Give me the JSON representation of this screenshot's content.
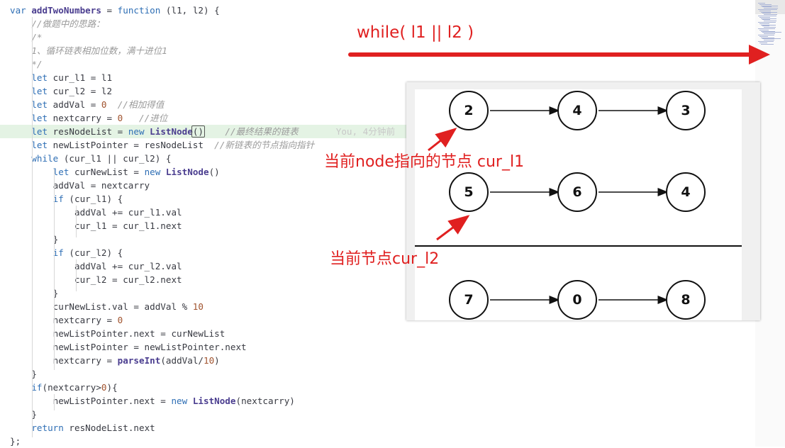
{
  "editor": {
    "lines": [
      {
        "segments": [
          {
            "t": "var ",
            "c": "kw"
          },
          {
            "t": "addTwoNumbers",
            "c": "fn"
          },
          {
            "t": " = "
          },
          {
            "t": "function",
            "c": "kw"
          },
          {
            "t": " (l1, l2) {"
          }
        ]
      },
      {
        "segments": [
          {
            "t": "    "
          },
          {
            "t": "//做题中的思路：",
            "c": "cm"
          }
        ]
      },
      {
        "segments": [
          {
            "t": "    "
          },
          {
            "t": "/*",
            "c": "cm"
          }
        ]
      },
      {
        "segments": [
          {
            "t": "    "
          },
          {
            "t": "1、循环链表相加位数，满十进位1",
            "c": "cm"
          }
        ]
      },
      {
        "segments": [
          {
            "t": "    "
          },
          {
            "t": "*/",
            "c": "cm"
          }
        ]
      },
      {
        "segments": [
          {
            "t": "    "
          },
          {
            "t": "let",
            "c": "kw"
          },
          {
            "t": " cur_l1 = l1"
          }
        ]
      },
      {
        "segments": [
          {
            "t": "    "
          },
          {
            "t": "let",
            "c": "kw"
          },
          {
            "t": " cur_l2 = l2"
          }
        ]
      },
      {
        "segments": [
          {
            "t": "    "
          },
          {
            "t": "let",
            "c": "kw"
          },
          {
            "t": " addVal = "
          },
          {
            "t": "0",
            "c": "num"
          },
          {
            "t": "  "
          },
          {
            "t": "//相加得值",
            "c": "cm"
          }
        ]
      },
      {
        "segments": [
          {
            "t": "    "
          },
          {
            "t": "let",
            "c": "kw"
          },
          {
            "t": " nextcarry = "
          },
          {
            "t": "0",
            "c": "num"
          },
          {
            "t": "   "
          },
          {
            "t": "//进位",
            "c": "cm"
          }
        ]
      },
      {
        "hl": true,
        "segments": [
          {
            "t": "    "
          },
          {
            "t": "let",
            "c": "kw"
          },
          {
            "t": " resNodeList = "
          },
          {
            "t": "new",
            "c": "kw"
          },
          {
            "t": " "
          },
          {
            "t": "ListNode",
            "c": "fn"
          },
          {
            "t": "()",
            "c": "cursor"
          },
          {
            "t": "    "
          },
          {
            "t": "//最终结果的链表",
            "c": "cm"
          },
          {
            "t": "       You, 4分钟前",
            "c": "blame"
          }
        ]
      },
      {
        "segments": [
          {
            "t": "    "
          },
          {
            "t": "let",
            "c": "kw"
          },
          {
            "t": " newListPointer = resNodeList  "
          },
          {
            "t": "//新链表的节点指向指针",
            "c": "cm"
          }
        ]
      },
      {
        "segments": [
          {
            "t": "    "
          },
          {
            "t": "while",
            "c": "kw"
          },
          {
            "t": " (cur_l1 || cur_l2) {"
          }
        ]
      },
      {
        "segments": [
          {
            "t": "        "
          },
          {
            "t": "let",
            "c": "kw"
          },
          {
            "t": " curNewList = "
          },
          {
            "t": "new",
            "c": "kw"
          },
          {
            "t": " "
          },
          {
            "t": "ListNode",
            "c": "fn"
          },
          {
            "t": "()"
          }
        ]
      },
      {
        "segments": [
          {
            "t": "        addVal = nextcarry"
          }
        ]
      },
      {
        "segments": [
          {
            "t": "        "
          },
          {
            "t": "if",
            "c": "kw"
          },
          {
            "t": " (cur_l1) {"
          }
        ]
      },
      {
        "segments": [
          {
            "t": "            addVal += cur_l1.val"
          }
        ]
      },
      {
        "segments": [
          {
            "t": "            cur_l1 = cur_l1.next"
          }
        ]
      },
      {
        "segments": [
          {
            "t": "        }"
          }
        ]
      },
      {
        "segments": [
          {
            "t": "        "
          },
          {
            "t": "if",
            "c": "kw"
          },
          {
            "t": " (cur_l2) {"
          }
        ]
      },
      {
        "segments": [
          {
            "t": "            addVal += cur_l2.val"
          }
        ]
      },
      {
        "segments": [
          {
            "t": "            cur_l2 = cur_l2.next"
          }
        ]
      },
      {
        "segments": [
          {
            "t": "        }"
          }
        ]
      },
      {
        "segments": [
          {
            "t": "        curNewList.val = addVal % "
          },
          {
            "t": "10",
            "c": "num"
          }
        ]
      },
      {
        "segments": [
          {
            "t": "        nextcarry = "
          },
          {
            "t": "0",
            "c": "num"
          }
        ]
      },
      {
        "segments": [
          {
            "t": "        newListPointer.next = curNewList"
          }
        ]
      },
      {
        "segments": [
          {
            "t": "        newListPointer = newListPointer.next"
          }
        ]
      },
      {
        "segments": [
          {
            "t": "        nextcarry = "
          },
          {
            "t": "parseInt",
            "c": "fn"
          },
          {
            "t": "(addVal/"
          },
          {
            "t": "10",
            "c": "num"
          },
          {
            "t": ")"
          }
        ]
      },
      {
        "segments": [
          {
            "t": "    }"
          }
        ]
      },
      {
        "segments": [
          {
            "t": "    "
          },
          {
            "t": "if",
            "c": "kw"
          },
          {
            "t": "(nextcarry>"
          },
          {
            "t": "0",
            "c": "num"
          },
          {
            "t": "){"
          }
        ]
      },
      {
        "segments": [
          {
            "t": "        newListPointer.next = "
          },
          {
            "t": "new",
            "c": "kw"
          },
          {
            "t": " "
          },
          {
            "t": "ListNode",
            "c": "fn"
          },
          {
            "t": "(nextcarry)"
          }
        ]
      },
      {
        "segments": [
          {
            "t": "    }"
          }
        ]
      },
      {
        "segments": [
          {
            "t": "    "
          },
          {
            "t": "return",
            "c": "kw"
          },
          {
            "t": " resNodeList.next"
          }
        ]
      },
      {
        "segments": [
          {
            "t": "};"
          }
        ]
      }
    ]
  },
  "annotation": {
    "title": "while( l1 || l2 )",
    "label_l1": "当前node指向的节点  cur_l1",
    "label_l2": "当前节点cur_l2",
    "color": "#e02020"
  },
  "diagram": {
    "lists": [
      [
        "2",
        "4",
        "3"
      ],
      [
        "5",
        "6",
        "4"
      ],
      [
        "7",
        "0",
        "8"
      ]
    ]
  }
}
